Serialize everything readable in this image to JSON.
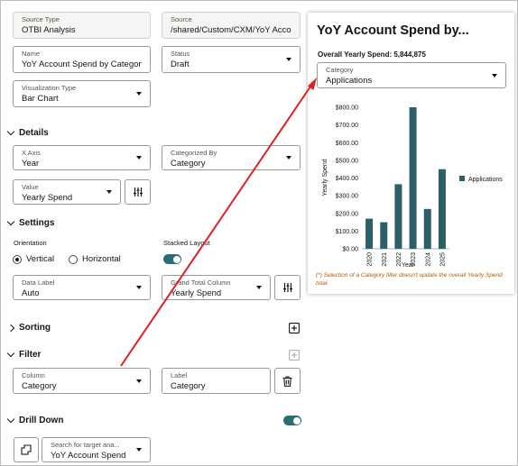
{
  "source": {
    "type_label": "Source Type",
    "type_value": "OTBI Analysis",
    "path_label": "Source",
    "path_value": "/shared/Custom/CXM/YoY Acco"
  },
  "name": {
    "label": "Name",
    "value": "YoY Account Spend by Category"
  },
  "status": {
    "label": "Status",
    "value": "Draft"
  },
  "viz_type": {
    "label": "Visualization Type",
    "value": "Bar Chart"
  },
  "details": {
    "title": "Details",
    "x_axis_label": "X Axis",
    "x_axis_value": "Year",
    "categorized_label": "Categorized By",
    "categorized_value": "Category",
    "value_label": "Value",
    "value_value": "Yearly Spend"
  },
  "settings": {
    "title": "Settings",
    "orientation_label": "Orientation",
    "vertical": "Vertical",
    "horizontal": "Horizontal",
    "stacked_label": "Stacked Layout",
    "data_label_label": "Data Label",
    "data_label_value": "Auto",
    "grand_total_label": "Grand Total Column",
    "grand_total_value": "Yearly Spend"
  },
  "sorting": {
    "title": "Sorting"
  },
  "filter": {
    "title": "Filter",
    "column_label": "Column",
    "column_value": "Category",
    "label_label": "Label",
    "label_value": "Category"
  },
  "drill": {
    "title": "Drill Down",
    "search_label": "Search for target ana...",
    "search_value": "YoY Account Spend"
  },
  "preview": {
    "title": "YoY Account Spend by...",
    "overall": "Overall Yearly Spend: 5,844,875",
    "category_label": "Category",
    "category_value": "Applications",
    "note": "(*) Selection of a Category filter doesn't update the overall Yearly Spend total."
  },
  "colors": {
    "bar": "#2b6068",
    "accent": "#2b6d74",
    "arrow": "#e02020",
    "note": "#b15b00"
  },
  "chart_data": {
    "type": "bar",
    "categories": [
      "2020",
      "2021",
      "2022",
      "2023",
      "2024",
      "2025"
    ],
    "series": [
      {
        "name": "Applications",
        "values": [
          170,
          150,
          365,
          800,
          225,
          450
        ]
      }
    ],
    "xlabel": "Year",
    "ylabel": "Yearly Spend",
    "ylim": [
      0,
      800
    ],
    "yticks": [
      "$0.00",
      "$100.00",
      "$200.00",
      "$300.00",
      "$400.00",
      "$500.00",
      "$600.00",
      "$700.00",
      "$800.00"
    ],
    "grid": false,
    "legend": "right"
  }
}
